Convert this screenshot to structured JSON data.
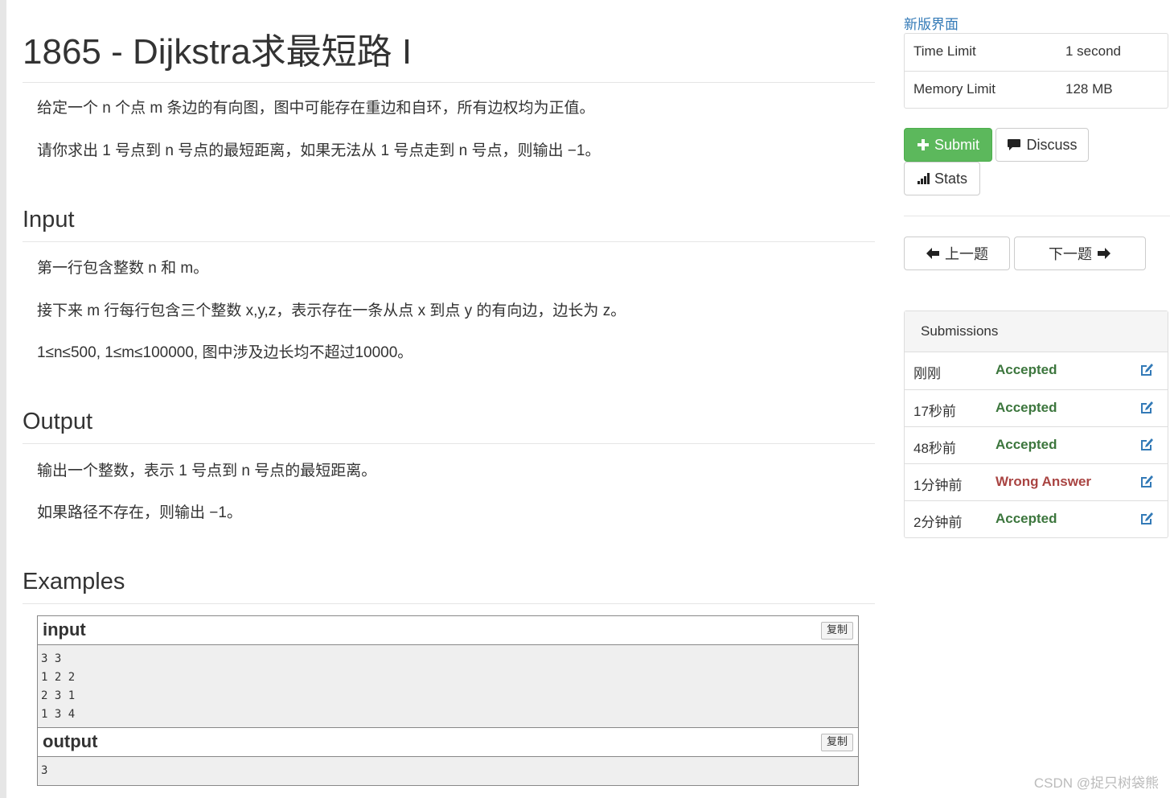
{
  "problem": {
    "title": "1865 - Dijkstra求最短路 I",
    "description": [
      "给定一个 n 个点 m 条边的有向图，图中可能存在重边和自环，所有边权均为正值。",
      "请你求出 1 号点到 n 号点的最短距离，如果无法从 1 号点走到 n 号点，则输出 −1。"
    ],
    "input_heading": "Input",
    "input_paras": [
      "第一行包含整数 n 和 m。",
      "接下来 m 行每行包含三个整数 x,y,z，表示存在一条从点 x 到点 y 的有向边，边长为 z。",
      "1≤n≤500, 1≤m≤100000, 图中涉及边长均不超过10000。"
    ],
    "output_heading": "Output",
    "output_paras": [
      "输出一个整数，表示 1 号点到 n 号点的最短距离。",
      "如果路径不存在，则输出 −1。"
    ],
    "examples_heading": "Examples",
    "sample_input": {
      "label": "input",
      "copy_label": "复制",
      "text": "3 3\n1 2 2\n2 3 1\n1 3 4"
    },
    "sample_output": {
      "label": "output",
      "copy_label": "复制",
      "text": "3"
    }
  },
  "sidebar": {
    "new_ui_link": "新版界面",
    "limits": [
      {
        "key": "Time Limit",
        "value": "1 second"
      },
      {
        "key": "Memory Limit",
        "value": "128 MB"
      }
    ],
    "buttons": {
      "submit": "Submit",
      "discuss": "Discuss",
      "stats": "Stats",
      "prev": "上一题",
      "next": "下一题"
    },
    "submissions": {
      "heading": "Submissions",
      "rows": [
        {
          "time": "刚刚",
          "status": "Accepted"
        },
        {
          "time": "17秒前",
          "status": "Accepted"
        },
        {
          "time": "48秒前",
          "status": "Accepted"
        },
        {
          "time": "1分钟前",
          "status": "Wrong Answer"
        },
        {
          "time": "2分钟前",
          "status": "Accepted"
        }
      ]
    }
  },
  "colors": {
    "accepted": "#3c763d",
    "wrong": "#a94442",
    "link": "#337ab7",
    "submit_green": "#5cb85c"
  },
  "watermark": "CSDN @捉只树袋熊"
}
